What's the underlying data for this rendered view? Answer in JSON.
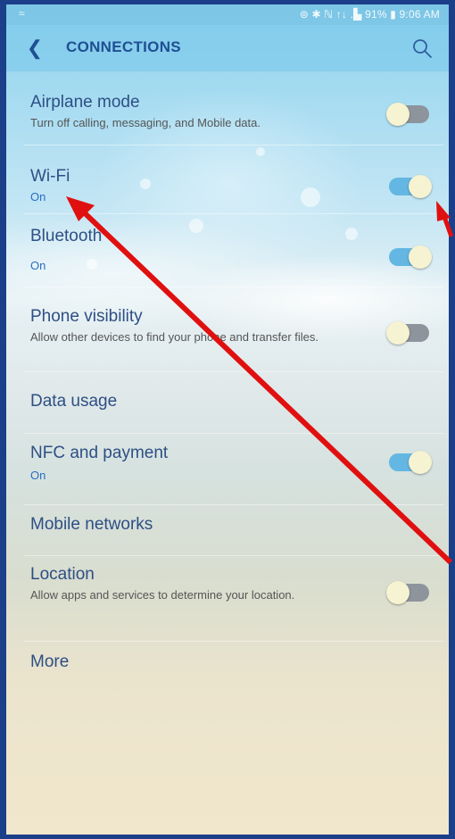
{
  "status_bar": {
    "left": "≈",
    "right": "⊚ ✱ ℕ ↑↓ .▙ 91% ▮ 9:06 AM"
  },
  "app_bar": {
    "back_icon": "back-chevron-icon",
    "title": "CONNECTIONS",
    "search_icon": "search-icon"
  },
  "settings": [
    {
      "title": "Airplane mode",
      "subtitle": "Turn off calling, messaging, and Mobile data.",
      "toggle": "off"
    },
    {
      "title": "Wi-Fi",
      "subtitle": "On",
      "toggle": "on"
    },
    {
      "title": "Bluetooth",
      "subtitle": "On",
      "toggle": "on"
    },
    {
      "title": "Phone visibility",
      "subtitle": "Allow other devices to find your phone and transfer files.",
      "toggle": "off"
    },
    {
      "title": "Data usage"
    },
    {
      "title": "NFC and payment",
      "subtitle": "On",
      "toggle": "on"
    },
    {
      "title": "Mobile networks"
    },
    {
      "title": "Location",
      "subtitle": "Allow apps and services to determine your location.",
      "toggle": "off"
    },
    {
      "title": "More"
    }
  ],
  "annotation_color": "#e01010",
  "accent_color": "#2a6ec3"
}
